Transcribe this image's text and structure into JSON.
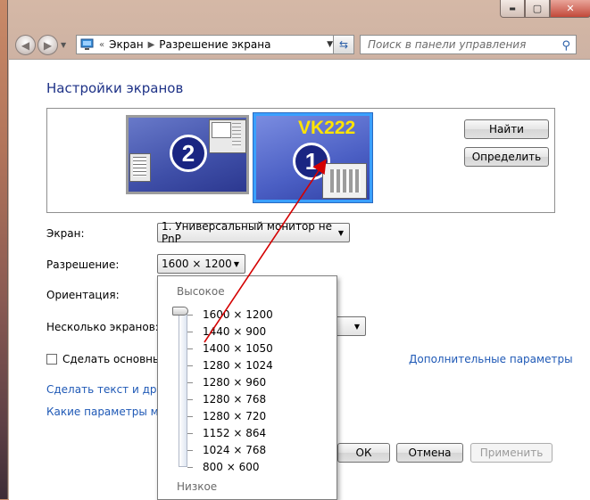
{
  "window": {
    "breadcrumb": [
      "Экран",
      "Разрешение экрана"
    ],
    "search_placeholder": "Поиск в панели управления",
    "caption_min": "▬",
    "caption_max": "▢",
    "caption_close": "✕"
  },
  "page": {
    "title": "Настройки экранов"
  },
  "monitors": {
    "m2": {
      "number": "2"
    },
    "m1": {
      "number": "1",
      "overlay_text": "VK222"
    }
  },
  "buttons": {
    "find": "Найти",
    "identify": "Определить",
    "ok": "ОК",
    "cancel": "Отмена",
    "apply": "Применить"
  },
  "form": {
    "screen_label": "Экран:",
    "screen_value": "1. Универсальный монитор не PnP",
    "resolution_label": "Разрешение:",
    "resolution_value": "1600 × 1200",
    "orientation_label": "Ориентация:",
    "multi_label": "Несколько экранов:",
    "make_main_label": "Сделать основным",
    "advanced_link": "Дополнительные параметры",
    "link_text_size": "Сделать текст и другие",
    "link_which_params": "Какие параметры мон"
  },
  "resolution_dropdown": {
    "high_label": "Высокое",
    "low_label": "Низкое",
    "options": [
      "1600 × 1200",
      "1440 × 900",
      "1400 × 1050",
      "1280 × 1024",
      "1280 × 960",
      "1280 × 768",
      "1280 × 720",
      "1152 × 864",
      "1024 × 768",
      "800 × 600"
    ],
    "selected_index": 0
  },
  "colors": {
    "title_blue": "#1e3287",
    "link_blue": "#1f59b6",
    "monitor_selected_border": "#3aa0ff",
    "vk_yellow": "#ffe400",
    "arrow_red": "#d40000"
  }
}
